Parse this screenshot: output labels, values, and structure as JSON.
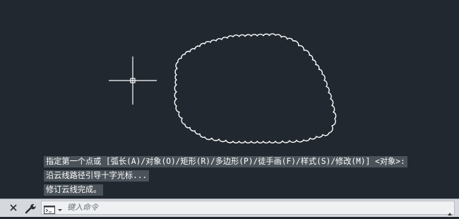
{
  "command_history": [
    "指定第一个点或 [弧长(A)/对象(O)/矩形(R)/多边形(P)/徒手画(F)/样式(S)/修改(M)] <对象>:",
    "沿云线路径引导十字光标...",
    "修订云线完成。"
  ],
  "command_line": {
    "placeholder": "键入命令"
  },
  "icons": {
    "close": "close-icon",
    "customize": "wrench-icon",
    "prompt": "command-prompt-icon",
    "crosshair": "crosshair-cursor-icon"
  },
  "colors": {
    "canvas_bg": "#212830",
    "drawing_stroke": "#ffffff",
    "command_bar_bg": "#d5d8dd"
  }
}
